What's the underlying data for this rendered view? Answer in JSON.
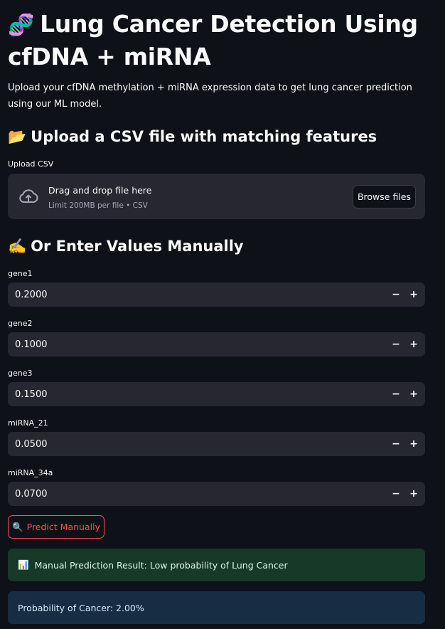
{
  "header": {
    "title_emoji": "🧬",
    "title": "Lung Cancer Detection Using cfDNA + miRNA",
    "subtitle": "Upload your cfDNA methylation + miRNA expression data to get lung cancer prediction using our ML model."
  },
  "upload_section": {
    "emoji": "📂",
    "heading": "Upload a CSV file with matching features",
    "label": "Upload CSV",
    "dropzone_text": "Drag and drop file here",
    "dropzone_limit": "Limit 200MB per file • CSV",
    "browse_label": "Browse files"
  },
  "manual_section": {
    "emoji": "✍️",
    "heading": "Or Enter Values Manually",
    "fields": [
      {
        "label": "gene1",
        "value": "0.2000"
      },
      {
        "label": "gene2",
        "value": "0.1000"
      },
      {
        "label": "gene3",
        "value": "0.1500"
      },
      {
        "label": "miRNA_21",
        "value": "0.0500"
      },
      {
        "label": "miRNA_34a",
        "value": "0.0700"
      }
    ],
    "minus": "−",
    "plus": "+"
  },
  "predict_button": {
    "icon": "🔍",
    "label": "Predict Manually"
  },
  "results": {
    "result_icon": "📊",
    "result_text": "Manual Prediction Result: Low probability of Lung Cancer",
    "probability_text": "Probability of Cancer: 2.00%"
  },
  "colors": {
    "background": "#0e1117",
    "widget": "#262730",
    "accent": "#ff4b4b",
    "success_bg": "#173928",
    "info_bg": "#172d43"
  }
}
